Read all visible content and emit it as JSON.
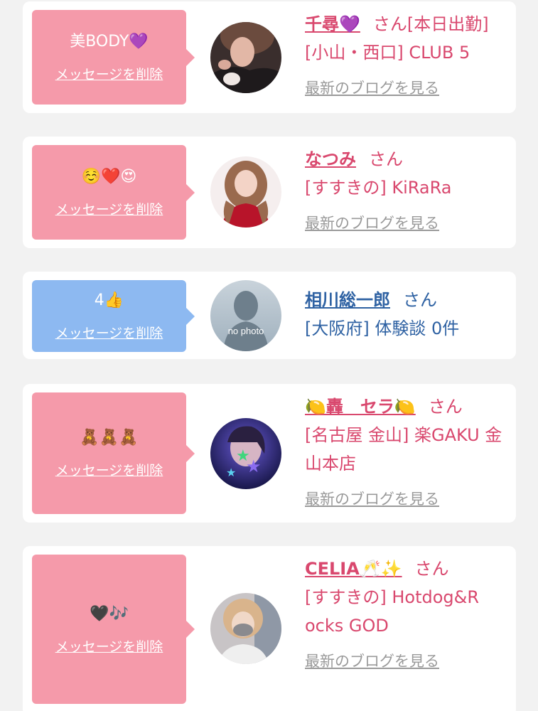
{
  "cards": [
    {
      "message": "美BODY💜",
      "delete_label": "メッセージを削除",
      "name": "千尋💜",
      "honorific": "さん[本日出勤]",
      "shop": "[小山・西口] CLUB 5",
      "blog_label": "最新のブログを見る",
      "bubble_color": "#f59aaa",
      "text_color": "#d9486e"
    },
    {
      "message": "☺️❤️😍",
      "delete_label": "メッセージを削除",
      "name": "なつみ",
      "honorific": "さん",
      "shop": "[すすきの] KiRaRa",
      "blog_label": "最新のブログを見る",
      "bubble_color": "#f59aaa",
      "text_color": "#d9486e"
    },
    {
      "message": "4👍",
      "delete_label": "メッセージを削除",
      "name": "相川総一郎",
      "honorific": "さん",
      "shop": "[大阪府] 体験談 0件",
      "avatar_text": "no photo",
      "bubble_color": "#8db9f1",
      "text_color": "#2f62a3"
    },
    {
      "message": "🧸🧸🧸",
      "delete_label": "メッセージを削除",
      "name": "🍋轟　セラ🍋",
      "honorific": "さん",
      "shop": "[名古屋 金山] 楽GAKU 金山本店",
      "blog_label": "最新のブログを見る",
      "bubble_color": "#f59aaa",
      "text_color": "#d9486e"
    },
    {
      "message": "🖤🎶",
      "delete_label": "メッセージを削除",
      "name": "CELIA🥂✨",
      "honorific": "さん",
      "shop": "[すすきの] Hotdog&Rocks GOD",
      "blog_label": "最新のブログを見る",
      "bubble_color": "#f59aaa",
      "text_color": "#d9486e"
    }
  ]
}
